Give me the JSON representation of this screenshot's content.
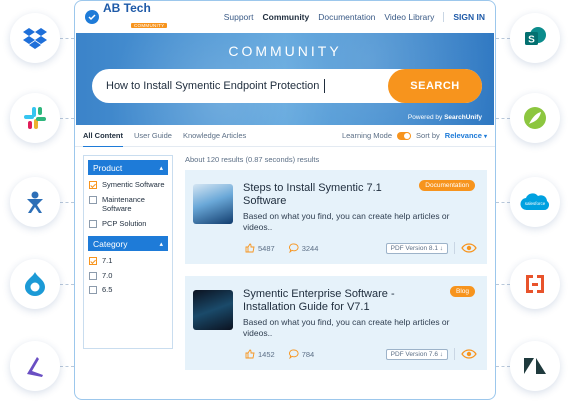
{
  "brand": {
    "name": "AB Tech",
    "sub": "COMMUNITY"
  },
  "nav": {
    "support": "Support",
    "community": "Community",
    "documentation": "Documentation",
    "video_library": "Video Library",
    "sign_in": "SIGN IN"
  },
  "hero": {
    "title": "COMMUNITY",
    "search_value": "How to Install Symentic Endpoint Protection",
    "search_button": "SEARCH",
    "powered_by": "Powered by",
    "powered_brand": "SearchUnify"
  },
  "tabs": {
    "all": "All Content",
    "user_guide": "User Guide",
    "knowledge": "Knowledge Articles",
    "learning_mode": "Learning Mode",
    "sort_by": "Sort by",
    "sort_value": "Relevance"
  },
  "filters": {
    "product": {
      "title": "Product",
      "items": [
        {
          "label": "Symentic Software",
          "checked": true
        },
        {
          "label": "Maintenance Software",
          "checked": false
        },
        {
          "label": "PCP Solution",
          "checked": false
        }
      ]
    },
    "category": {
      "title": "Category",
      "items": [
        {
          "label": "7.1",
          "checked": true
        },
        {
          "label": "7.0",
          "checked": false
        },
        {
          "label": "6.5",
          "checked": false
        }
      ]
    }
  },
  "results_meta": "About 120 results (0.87 seconds) results",
  "results": [
    {
      "title": "Steps to Install Symentic 7.1 Software",
      "tag": "Documentation",
      "desc": "Based on what you find, you can create help articles or videos..",
      "likes": "5487",
      "comments": "3244",
      "pdf": "PDF Version 8.1 ↓"
    },
    {
      "title": "Symentic Enterprise Software - Installation Guide for V7.1",
      "tag": "Blog",
      "desc": "Based on what you find, you can create help articles or videos..",
      "likes": "1452",
      "comments": "784",
      "pdf": "PDF Version 7.6 ↓"
    }
  ],
  "colors": {
    "primary": "#1e7bd8",
    "accent": "#f7941d",
    "card": "#e6f2fa"
  },
  "integrations_left": [
    "dropbox-icon",
    "slack-icon",
    "confluence-icon",
    "drupal-icon",
    "arrow-logo-icon"
  ],
  "integrations_right": [
    "sharepoint-icon",
    "feather-icon",
    "salesforce-icon",
    "h-logo-icon",
    "zendesk-icon"
  ]
}
